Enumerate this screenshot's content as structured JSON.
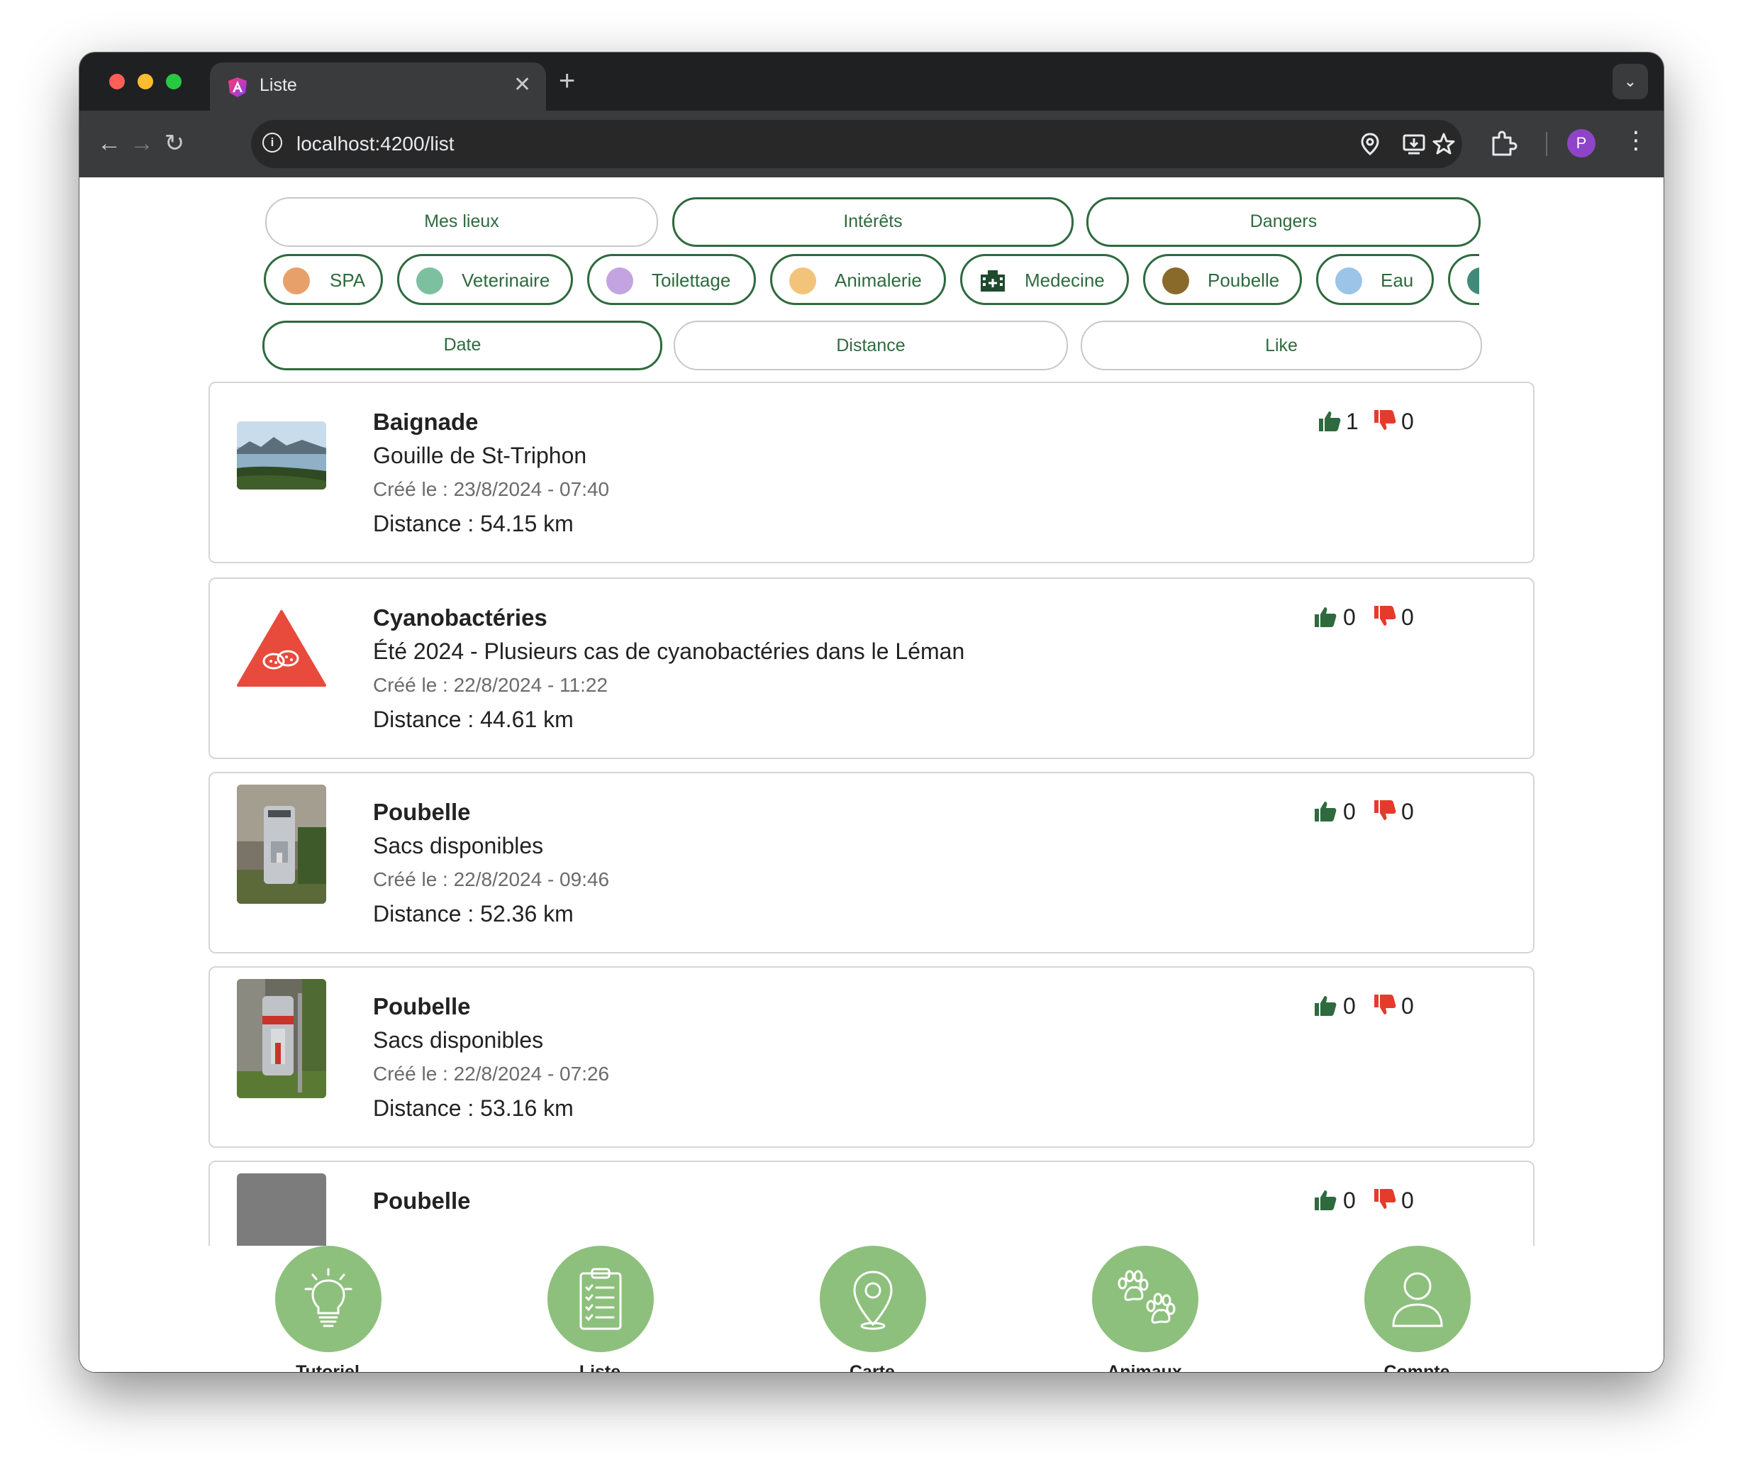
{
  "browser": {
    "tab_title": "Liste",
    "url": "localhost:4200/list",
    "profile_initial": "P"
  },
  "filters": {
    "categories": [
      {
        "label": "Mes lieux",
        "active": false
      },
      {
        "label": "Intérêts",
        "active": true
      },
      {
        "label": "Dangers",
        "active": true
      }
    ],
    "types": [
      {
        "label": "SPA",
        "icon": "spa-icon",
        "color": "#e8a06a"
      },
      {
        "label": "Veterinaire",
        "icon": "veterinaire-icon",
        "color": "#7dc0a0"
      },
      {
        "label": "Toilettage",
        "icon": "toilettage-icon",
        "color": "#c3a4e0"
      },
      {
        "label": "Animalerie",
        "icon": "animalerie-icon",
        "color": "#f2c47a"
      },
      {
        "label": "Medecine",
        "icon": "medecine-icon",
        "color": "#1f4a2e"
      },
      {
        "label": "Poubelle",
        "icon": "poubelle-icon",
        "color": "#8a6a2a"
      },
      {
        "label": "Eau",
        "icon": "eau-icon",
        "color": "#9cc4e8"
      }
    ],
    "sort": [
      {
        "label": "Date",
        "active": true
      },
      {
        "label": "Distance",
        "active": false
      },
      {
        "label": "Like",
        "active": false
      }
    ]
  },
  "items": [
    {
      "title": "Baignade",
      "description": "Gouille de St-Triphon",
      "created": "Créé le : 23/8/2024 - 07:40",
      "distance": "Distance : 54.15 km",
      "likes": "1",
      "dislikes": "0",
      "image": "lake-photo"
    },
    {
      "title": "Cyanobactéries",
      "description": "Été 2024 - Plusieurs cas de cyanobactéries dans le Léman",
      "created": "Créé le : 22/8/2024 - 11:22",
      "distance": "Distance : 44.61 km",
      "likes": "0",
      "dislikes": "0",
      "image": "bacteria-warning-icon"
    },
    {
      "title": "Poubelle",
      "description": "Sacs disponibles",
      "created": "Créé le : 22/8/2024 - 09:46",
      "distance": "Distance : 52.36 km",
      "likes": "0",
      "dislikes": "0",
      "image": "bin-photo"
    },
    {
      "title": "Poubelle",
      "description": "Sacs disponibles",
      "created": "Créé le : 22/8/2024 - 07:26",
      "distance": "Distance : 53.16 km",
      "likes": "0",
      "dislikes": "0",
      "image": "bin-photo"
    },
    {
      "title": "Poubelle",
      "likes": "0",
      "dislikes": "0",
      "image": "bin-photo"
    }
  ],
  "bottom_nav": [
    {
      "label": "Tutoriel",
      "icon": "lightbulb-icon"
    },
    {
      "label": "Liste",
      "icon": "clipboard-list-icon"
    },
    {
      "label": "Carte",
      "icon": "map-pin-icon"
    },
    {
      "label": "Animaux",
      "icon": "paws-icon"
    },
    {
      "label": "Compte",
      "icon": "user-icon"
    }
  ],
  "colors": {
    "accent_green": "#2e6a3e",
    "nav_green": "#8dc07c",
    "like_green": "#2e6a3e",
    "dislike_red": "#e53b2c",
    "danger_red": "#e84a3c"
  }
}
